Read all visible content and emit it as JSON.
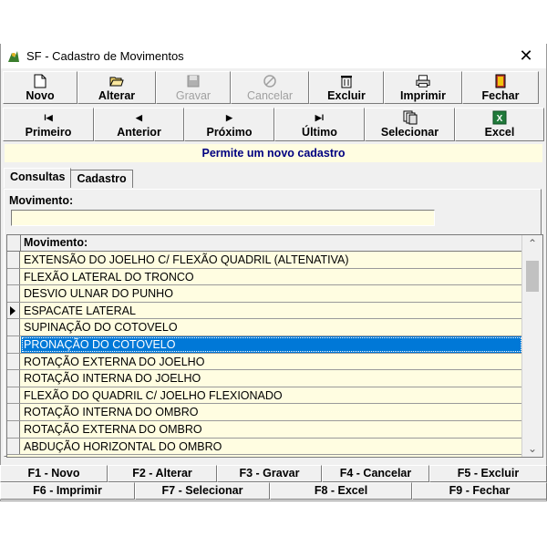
{
  "window": {
    "title": "SF - Cadastro de Movimentos",
    "close_glyph": "✕"
  },
  "toolbar1": [
    {
      "label": "Novo",
      "icon": "new-document-icon",
      "enabled": true
    },
    {
      "label": "Alterar",
      "icon": "open-folder-icon",
      "enabled": true
    },
    {
      "label": "Gravar",
      "icon": "save-disk-icon",
      "enabled": false
    },
    {
      "label": "Cancelar",
      "icon": "cancel-icon",
      "enabled": false
    },
    {
      "label": "Excluir",
      "icon": "trash-icon",
      "enabled": true
    },
    {
      "label": "Imprimir",
      "icon": "printer-icon",
      "enabled": true
    },
    {
      "label": "Fechar",
      "icon": "exit-door-icon",
      "enabled": true
    }
  ],
  "toolbar2": [
    {
      "label": "Primeiro",
      "icon": "first-record-icon",
      "glyph": "I◀"
    },
    {
      "label": "Anterior",
      "icon": "previous-record-icon",
      "glyph": "◀"
    },
    {
      "label": "Próximo",
      "icon": "next-record-icon",
      "glyph": "▶"
    },
    {
      "label": "Último",
      "icon": "last-record-icon",
      "glyph": "▶I"
    },
    {
      "label": "Selecionar",
      "icon": "select-pages-icon",
      "glyph": ""
    },
    {
      "label": "Excel",
      "icon": "excel-icon",
      "glyph": ""
    }
  ],
  "hint": "Permite um novo cadastro",
  "tabs": [
    {
      "label": "Consultas",
      "active": true
    },
    {
      "label": "Cadastro",
      "active": false
    }
  ],
  "filter": {
    "label": "Movimento:",
    "value": ""
  },
  "grid": {
    "column": "Movimento:",
    "selected_index": 5,
    "current_index": 3,
    "rows": [
      "EXTENSÃO DO JOELHO C/ FLEXÃO QUADRIL (ALTENATIVA)",
      "FLEXÃO LATERAL DO TRONCO",
      "DESVIO ULNAR DO PUNHO",
      "ESPACATE LATERAL",
      "SUPINAÇÃO DO COTOVELO",
      "PRONAÇÃO DO COTOVELO",
      "ROTAÇÃO EXTERNA DO JOELHO",
      "ROTAÇÃO INTERNA DO JOELHO",
      "FLEXÃO DO QUADRIL C/ JOELHO FLEXIONADO",
      "ROTAÇÃO INTERNA DO OMBRO",
      "ROTAÇÃO EXTERNA DO OMBRO",
      "ABDUÇÃO HORIZONTAL DO OMBRO"
    ]
  },
  "fkeys_row1": [
    "F1 - Novo",
    "F2 - Alterar",
    "F3 - Gravar",
    "F4 - Cancelar",
    "F5 - Excluir"
  ],
  "fkeys_row2": [
    "F6 - Imprimir",
    "F7 - Selecionar",
    "F8 - Excel",
    "F9 - Fechar"
  ],
  "colors": {
    "accent_selection": "#0078d7",
    "hint_text": "#000080",
    "field_bg": "#fffde1"
  }
}
